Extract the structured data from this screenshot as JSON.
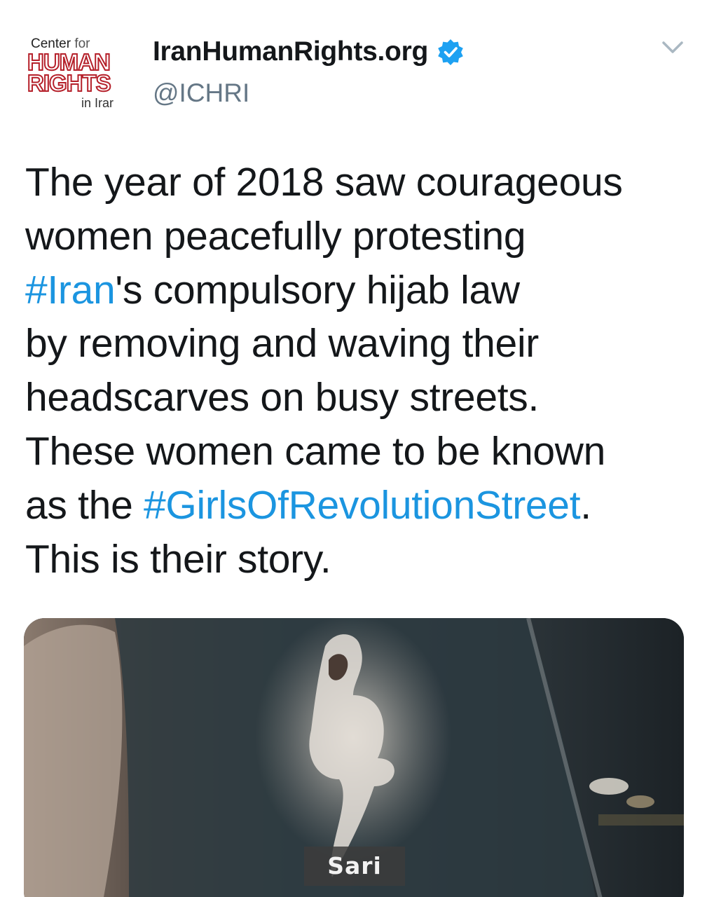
{
  "author": {
    "logo": {
      "line1_center": "Center",
      "line1_for": "for",
      "line2": "HUMAN",
      "line3": "RIGHTS",
      "line4": "in Irar"
    },
    "display_name": "IranHumanRights.org",
    "handle": "@ICHRI",
    "verified_icon": "verified-badge-icon",
    "caret_icon": "chevron-down-icon"
  },
  "tweet": {
    "lines": [
      [
        {
          "text": "The year of 2018 saw courageous",
          "hashtag": false
        }
      ],
      [
        {
          "text": "women peacefully protesting",
          "hashtag": false
        }
      ],
      [
        {
          "text": "#Iran",
          "hashtag": true
        },
        {
          "text": "'s compulsory hijab law",
          "hashtag": false
        }
      ],
      [
        {
          "text": "by removing and waving their",
          "hashtag": false
        }
      ],
      [
        {
          "text": "headscarves on busy streets.",
          "hashtag": false
        }
      ],
      [
        {
          "text": "These women came to be known",
          "hashtag": false
        }
      ],
      [
        {
          "text": "as the ",
          "hashtag": false
        },
        {
          "text": "#GirlsOfRevolutionStreet",
          "hashtag": true
        },
        {
          "text": ".",
          "hashtag": false
        }
      ],
      [
        {
          "text": "This is their story.",
          "hashtag": false
        }
      ]
    ]
  },
  "media": {
    "caption": "Sari"
  },
  "colors": {
    "hashtag": "#1b95e0",
    "verified": "#1da1f2",
    "logo_red": "#b5202a",
    "handle": "#657786"
  }
}
